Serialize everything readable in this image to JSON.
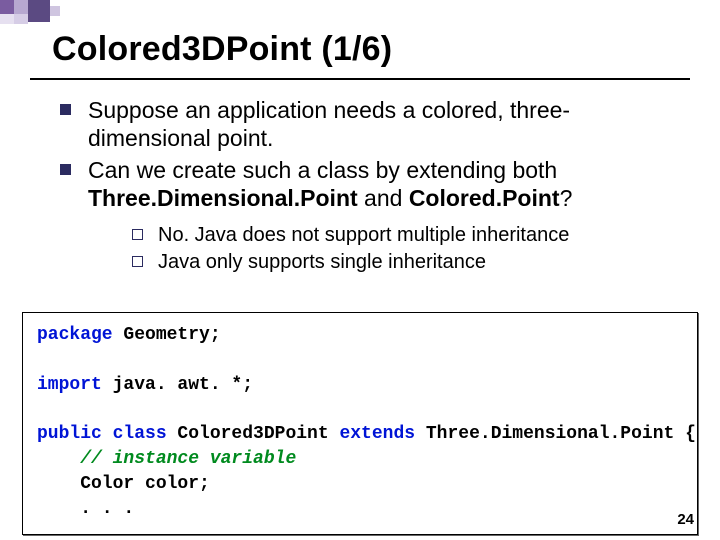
{
  "title": "Colored3DPoint (1/6)",
  "bullets_lvl1": [
    "Suppose an application needs a colored, three-dimensional point.",
    {
      "pre": "Can we create such a class by extending both ",
      "b1": "Three.Dimensional.Point",
      "mid": " and ",
      "b2": "Colored.Point",
      "post": "?"
    }
  ],
  "bullets_lvl2": [
    "No. Java does not support multiple inheritance",
    "Java only supports single inheritance"
  ],
  "code": {
    "l1_kw": "package",
    "l1_rest": " Geometry;",
    "l2_kw": "import",
    "l2_rest": " java. awt. *;",
    "l3_kw1": "public class",
    "l3_name": " Colored3DPoint ",
    "l3_kw2": "extends",
    "l3_rest": " Three.Dimensional.Point {",
    "l4_comment": "    // instance variable",
    "l5": "    Color color;",
    "l6": "    . . ."
  },
  "page_number": "24"
}
